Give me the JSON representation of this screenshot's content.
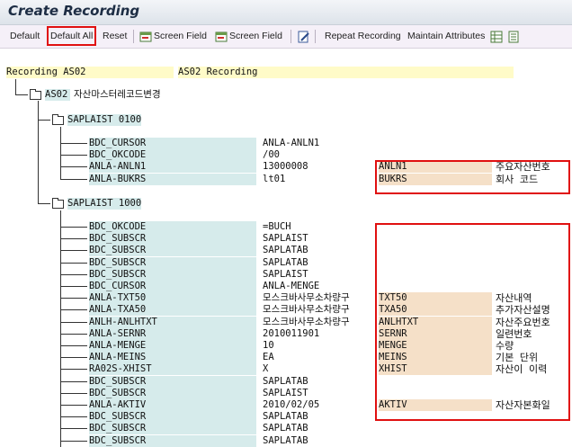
{
  "title": "Create Recording",
  "toolbar": {
    "default": "Default",
    "default_all": "Default All",
    "reset": "Reset",
    "screen_field_1": "Screen Field",
    "screen_field_2": "Screen Field",
    "repeat_recording": "Repeat Recording",
    "maintain_attributes": "Maintain Attributes"
  },
  "recording": {
    "label": "Recording AS02",
    "value": "AS02 Recording"
  },
  "transaction": {
    "code": "AS02",
    "desc": "자산마스터레코드변경"
  },
  "screen1": {
    "label": "SAPLAIST 0100"
  },
  "screen2": {
    "label": "SAPLAIST 1000"
  },
  "rows1": [
    {
      "field": "BDC_CURSOR",
      "value": "ANLA-ANLN1",
      "tech": "",
      "text": ""
    },
    {
      "field": "BDC_OKCODE",
      "value": "/00",
      "tech": "",
      "text": ""
    },
    {
      "field": "ANLA-ANLN1",
      "value": "13000008",
      "tech": "ANLN1",
      "text": "주요자산번호"
    },
    {
      "field": "ANLA-BUKRS",
      "value": "lt01",
      "tech": "BUKRS",
      "text": "회사 코드"
    }
  ],
  "rows2": [
    {
      "field": "BDC_OKCODE",
      "value": "=BUCH",
      "tech": "",
      "text": ""
    },
    {
      "field": "BDC_SUBSCR",
      "value": "SAPLAIST",
      "tech": "",
      "text": ""
    },
    {
      "field": "BDC_SUBSCR",
      "value": "SAPLATAB",
      "tech": "",
      "text": ""
    },
    {
      "field": "BDC_SUBSCR",
      "value": "SAPLATAB",
      "tech": "",
      "text": ""
    },
    {
      "field": "BDC_SUBSCR",
      "value": "SAPLAIST",
      "tech": "",
      "text": ""
    },
    {
      "field": "BDC_CURSOR",
      "value": "ANLA-MENGE",
      "tech": "",
      "text": ""
    },
    {
      "field": "ANLA-TXT50",
      "value": "모스크바사무소차량구",
      "tech": "TXT50",
      "text": "자산내역"
    },
    {
      "field": "ANLA-TXA50",
      "value": "모스크바사무소차량구",
      "tech": "TXA50",
      "text": "추가자산설명"
    },
    {
      "field": "ANLH-ANLHTXT",
      "value": "모스크바사무소차량구",
      "tech": "ANLHTXT",
      "text": "자산주요번호"
    },
    {
      "field": "ANLA-SERNR",
      "value": "2010011901",
      "tech": "SERNR",
      "text": "일련번호"
    },
    {
      "field": "ANLA-MENGE",
      "value": "10",
      "tech": "MENGE",
      "text": "수량"
    },
    {
      "field": "ANLA-MEINS",
      "value": "EA",
      "tech": "MEINS",
      "text": "기본 단위"
    },
    {
      "field": "RA02S-XHIST",
      "value": "X",
      "tech": "XHIST",
      "text": "자산이 이력"
    },
    {
      "field": "BDC_SUBSCR",
      "value": "SAPLATAB",
      "tech": "",
      "text": ""
    },
    {
      "field": "BDC_SUBSCR",
      "value": "SAPLAIST",
      "tech": "",
      "text": ""
    },
    {
      "field": "ANLA-AKTIV",
      "value": "2010/02/05",
      "tech": "AKTIV",
      "text": "자산자본화일"
    },
    {
      "field": "BDC_SUBSCR",
      "value": "SAPLATAB",
      "tech": "",
      "text": ""
    },
    {
      "field": "BDC_SUBSCR",
      "value": "SAPLATAB",
      "tech": "",
      "text": ""
    },
    {
      "field": "BDC_SUBSCR",
      "value": "SAPLATAB",
      "tech": "",
      "text": ""
    }
  ],
  "colors": {
    "teal": "#d6ebeb",
    "yellow": "#fffbc8",
    "peach": "#f5e0c8",
    "highlight": "#e01010"
  }
}
